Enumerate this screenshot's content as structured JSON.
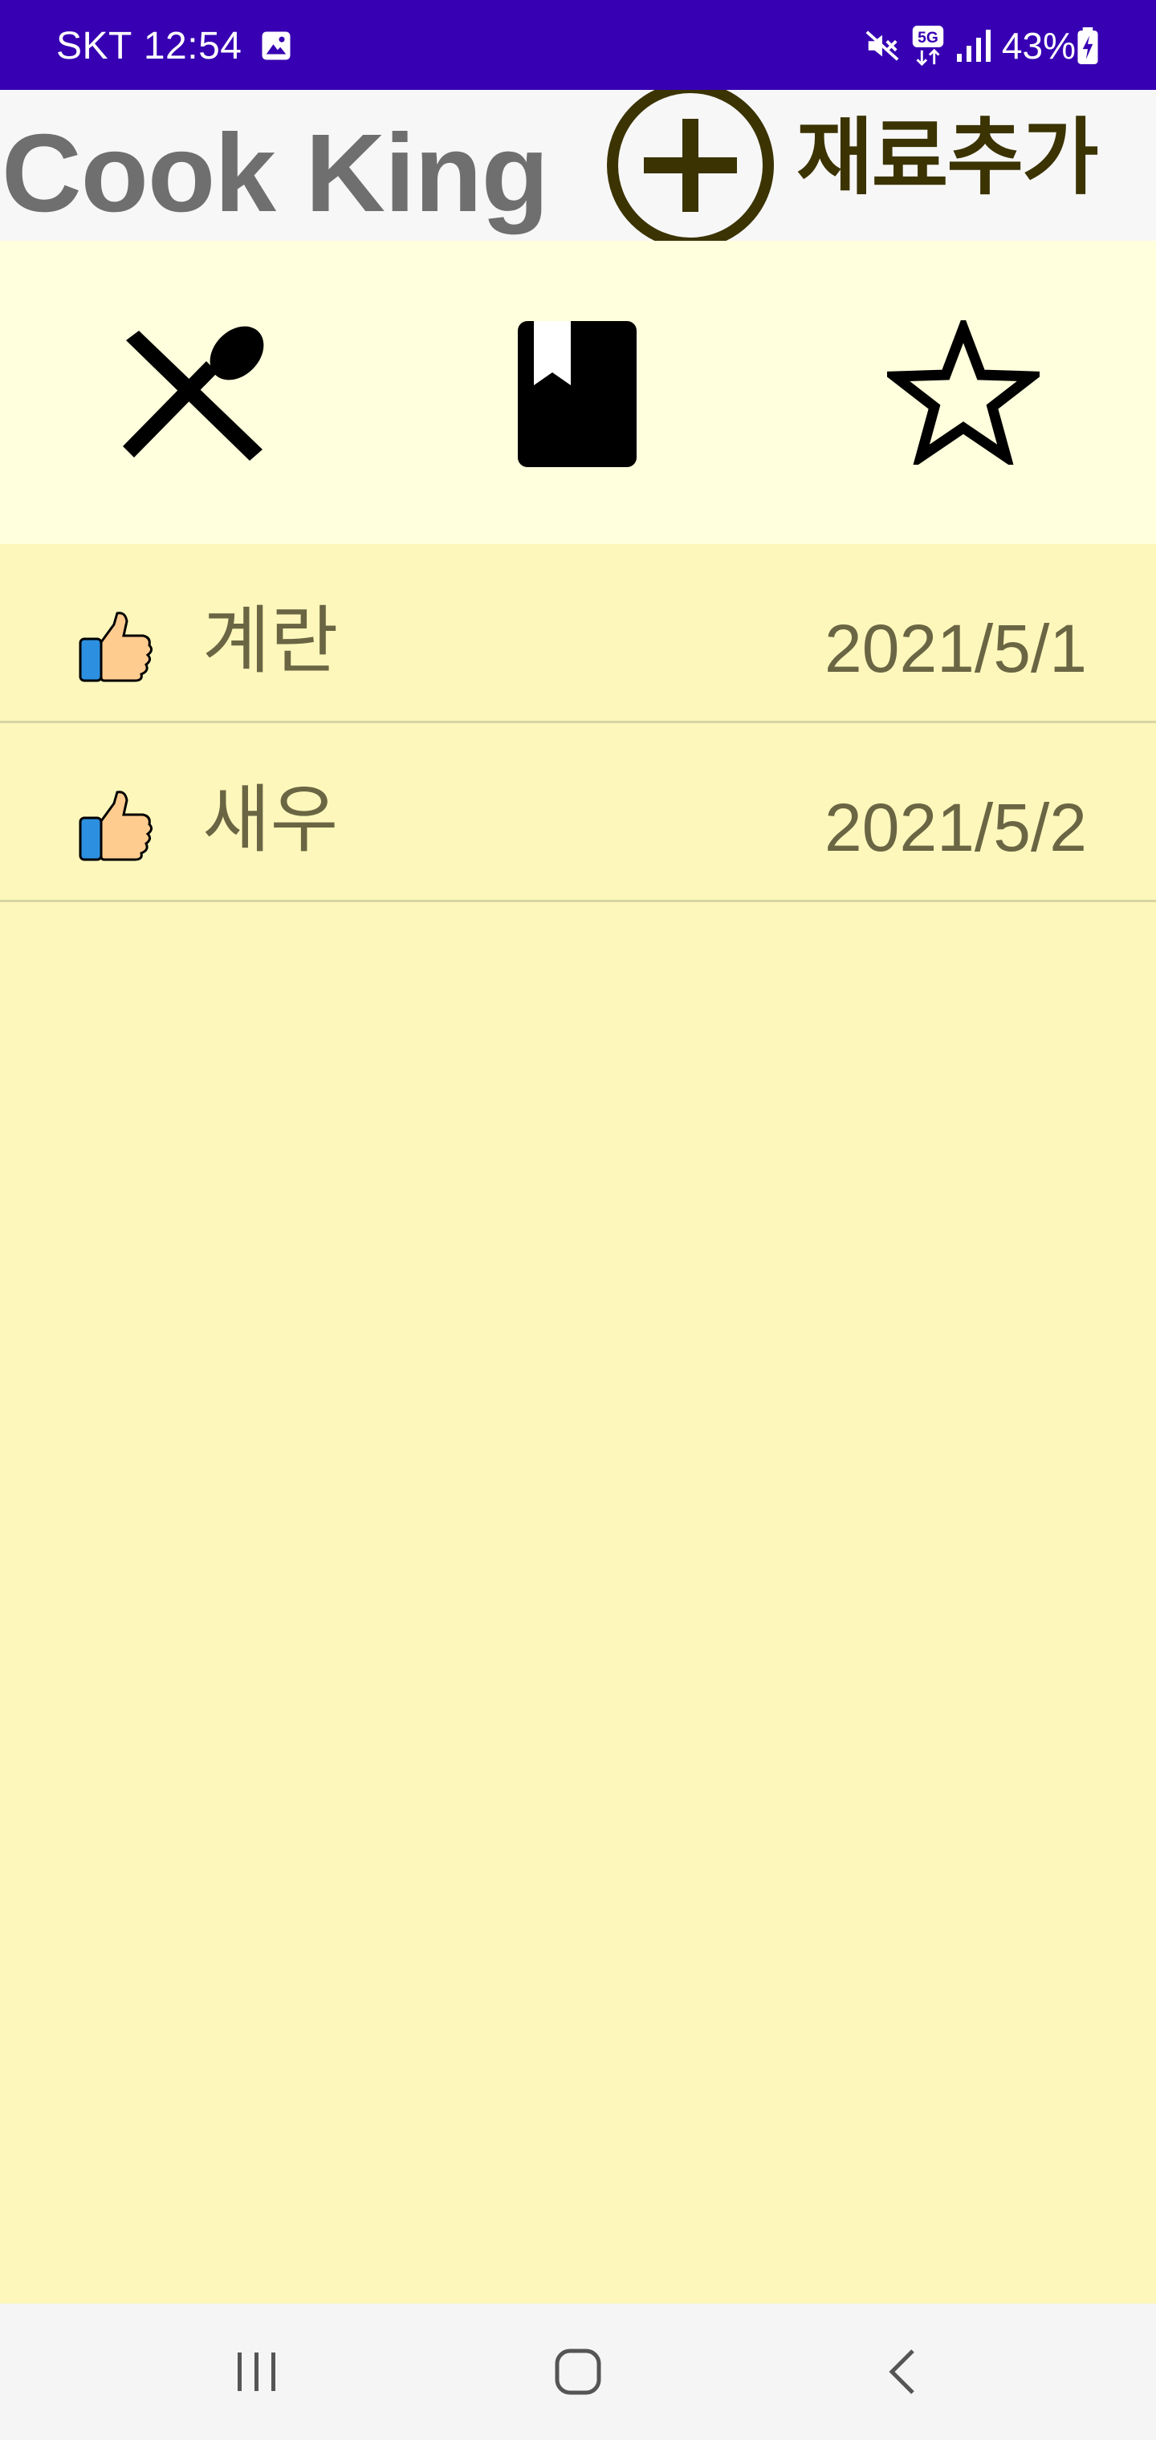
{
  "status_bar": {
    "carrier": "SKT",
    "time": "12:54",
    "network": "5G",
    "battery": "43%",
    "icons": [
      "image-icon",
      "mute-icon",
      "network-5g-icon",
      "signal-icon",
      "battery-charging-icon"
    ]
  },
  "header": {
    "title": "Cook King",
    "add_button_label": "재료추가",
    "add_button_icon": "plus-circle-icon",
    "accent_color": "#3b3302"
  },
  "tabs": [
    {
      "name": "recipes",
      "icon": "fork-spoon-icon"
    },
    {
      "name": "bookmark",
      "icon": "bookmark-book-icon"
    },
    {
      "name": "favorites",
      "icon": "star-outline-icon"
    }
  ],
  "ingredients": [
    {
      "name": "계란",
      "date": "2021/5/1",
      "icon": "thumbs-up-icon"
    },
    {
      "name": "새우",
      "date": "2021/5/2",
      "icon": "thumbs-up-icon"
    }
  ],
  "nav_bar": {
    "buttons": [
      "recent-apps-icon",
      "home-icon",
      "back-icon"
    ]
  },
  "colors": {
    "status_bar": "#3700b3",
    "header_bg": "#f7f7f7",
    "tab_bar_bg": "#ffffdd",
    "list_bg": "#fdf7bb",
    "text": "#6a6543"
  }
}
